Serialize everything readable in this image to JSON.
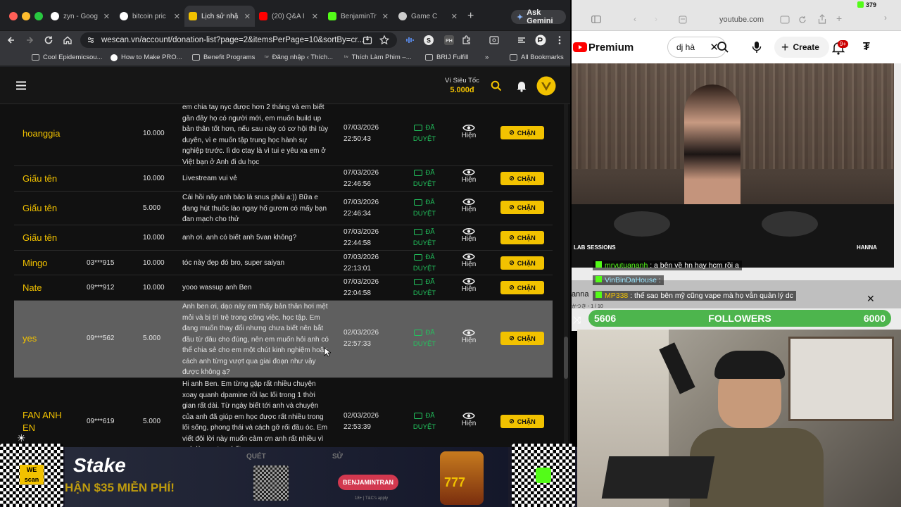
{
  "tabs": [
    {
      "label": "zyn - Goog",
      "color": "#4285f4"
    },
    {
      "label": "bitcoin pric",
      "color": "#4285f4"
    },
    {
      "label": "Lịch sử nhậ",
      "color": "#f2c200"
    },
    {
      "label": "(20) Q&A I",
      "color": "#ff0000"
    },
    {
      "label": "BenjaminTr",
      "color": "#53fc18"
    },
    {
      "label": "Game C",
      "color": "#dddddd"
    }
  ],
  "ask_gemini": "Ask Gemini",
  "url": "wescan.vn/account/donation-list?page=2&itemsPerPage=10&sortBy=cr...",
  "bookmarks": [
    "Cool Epidemicsou...",
    "How to Make PRO...",
    "Benefit Programs",
    "Đăng nhập ‹ Thích...",
    "Thích Làm Phim –...",
    "BRIJ Fulfill",
    "»",
    "All Bookmarks"
  ],
  "wallet": {
    "label": "Ví Siêu Tốc",
    "amount": "5.000đ"
  },
  "status_label": {
    "line1": "ĐÃ",
    "line2": "DUYỆT"
  },
  "visible_label": "Hiện",
  "ban_label": "CHẶN",
  "rows": [
    {
      "name": "hoanggia",
      "phone": "",
      "amount": "10.000",
      "msg": "em chia tay nyc được hơn 2 tháng và em biết gần đây họ có người mới, em muốn build up bản thân tốt hơn, nếu sau này có cơ hội thì tùy duyên, vì e muốn tập trung học hành sự nghiệp trước. lì do ctay là vì tui e yêu xa em ở Việt bạn ở Anh đi du học",
      "date": "07/03/2026",
      "time": "22:50:43"
    },
    {
      "name": "Giấu tên",
      "phone": "",
      "amount": "10.000",
      "msg": "Livestream vui vẻ",
      "date": "07/03/2026",
      "time": "22:46:56"
    },
    {
      "name": "Giấu tên",
      "phone": "",
      "amount": "5.000",
      "msg": "Cái hồi nãy anh bảo là snus phải a:)) Bữa e đang hút thuốc lào ngay hố gươm có mấy bạn đan mạch cho thử",
      "date": "07/03/2026",
      "time": "22:46:34"
    },
    {
      "name": "Giấu tên",
      "phone": "",
      "amount": "10.000",
      "msg": "anh ơi. anh có biết anh 5van không?",
      "date": "07/03/2026",
      "time": "22:44:58"
    },
    {
      "name": "Mingo",
      "phone": "03***915",
      "amount": "10.000",
      "msg": "tóc này đẹp đó bro, super saiyan",
      "date": "07/03/2026",
      "time": "22:13:01"
    },
    {
      "name": "Nate",
      "phone": "09***912",
      "amount": "10.000",
      "msg": "yooo wassup anh Ben",
      "date": "07/03/2026",
      "time": "22:04:58"
    },
    {
      "name": "yes",
      "phone": "09***562",
      "amount": "5.000",
      "msg": "Anh ben ơi, dạo này em thấy bản thân hơi mệt mỏi và bị trì trệ trong công việc, học tập. Em đang muốn thay đổi nhưng chưa biết nên bắt đầu từ đâu cho đúng, nên em muốn hỏi anh có thể chia sẻ cho em một chút kinh nghiệm hoặc cách anh từng vượt qua giai đoạn như vậy được không ạ?",
      "date": "02/03/2026",
      "time": "22:57:33"
    },
    {
      "name": "FAN ANH EN",
      "phone": "09***619",
      "amount": "5.000",
      "msg": "Hi anh Ben. Em từng gặp rất nhiều chuyện xoay quanh dpamine rồi lạc lối trong 1 thời gian rất dài. Từ ngày biết tới anh và chuyện của anh đã giúp em học được rất nhiều trong lối sống, phong thái và cách gỡ rối đầu óc. Em viết đôi lời này muốn cảm ơn anh rất nhiều vì anh là mentor nhất em",
      "date": "02/03/2026",
      "time": "22:53:39"
    }
  ],
  "banner": {
    "stake": "Stake",
    "promo": "HẬN $35 MIỄN PHÍ!",
    "quet": "QUÉT",
    "su": "SỬ",
    "code": "BENJAMINTRAN",
    "tc": "18+ | T&C's apply",
    "slot": "777",
    "wescan": "WE scan"
  },
  "youtube": {
    "domain": "youtube.com",
    "premium": "Premium",
    "search": "dj hà",
    "create": "Create",
    "notif": "9+",
    "battery": "379"
  },
  "video": {
    "tag": "LAB SESSIONS",
    "name": "HANNA"
  },
  "chat": [
    {
      "user": "mrvutuananh",
      "text": ": a bên về hn hay hcm rồi a"
    },
    {
      "user": "VinBinDaHouse",
      "text": ":"
    },
    {
      "user": "MP338",
      "text": ": thế sao bên mỹ cũng vape mà họ vẫn quản lý dc"
    }
  ],
  "chat_extra": "anna",
  "chat_sub": "かつき - 1 / 10",
  "followers": {
    "current": "5606",
    "label": "FOLLOWERS",
    "goal": "6000"
  }
}
